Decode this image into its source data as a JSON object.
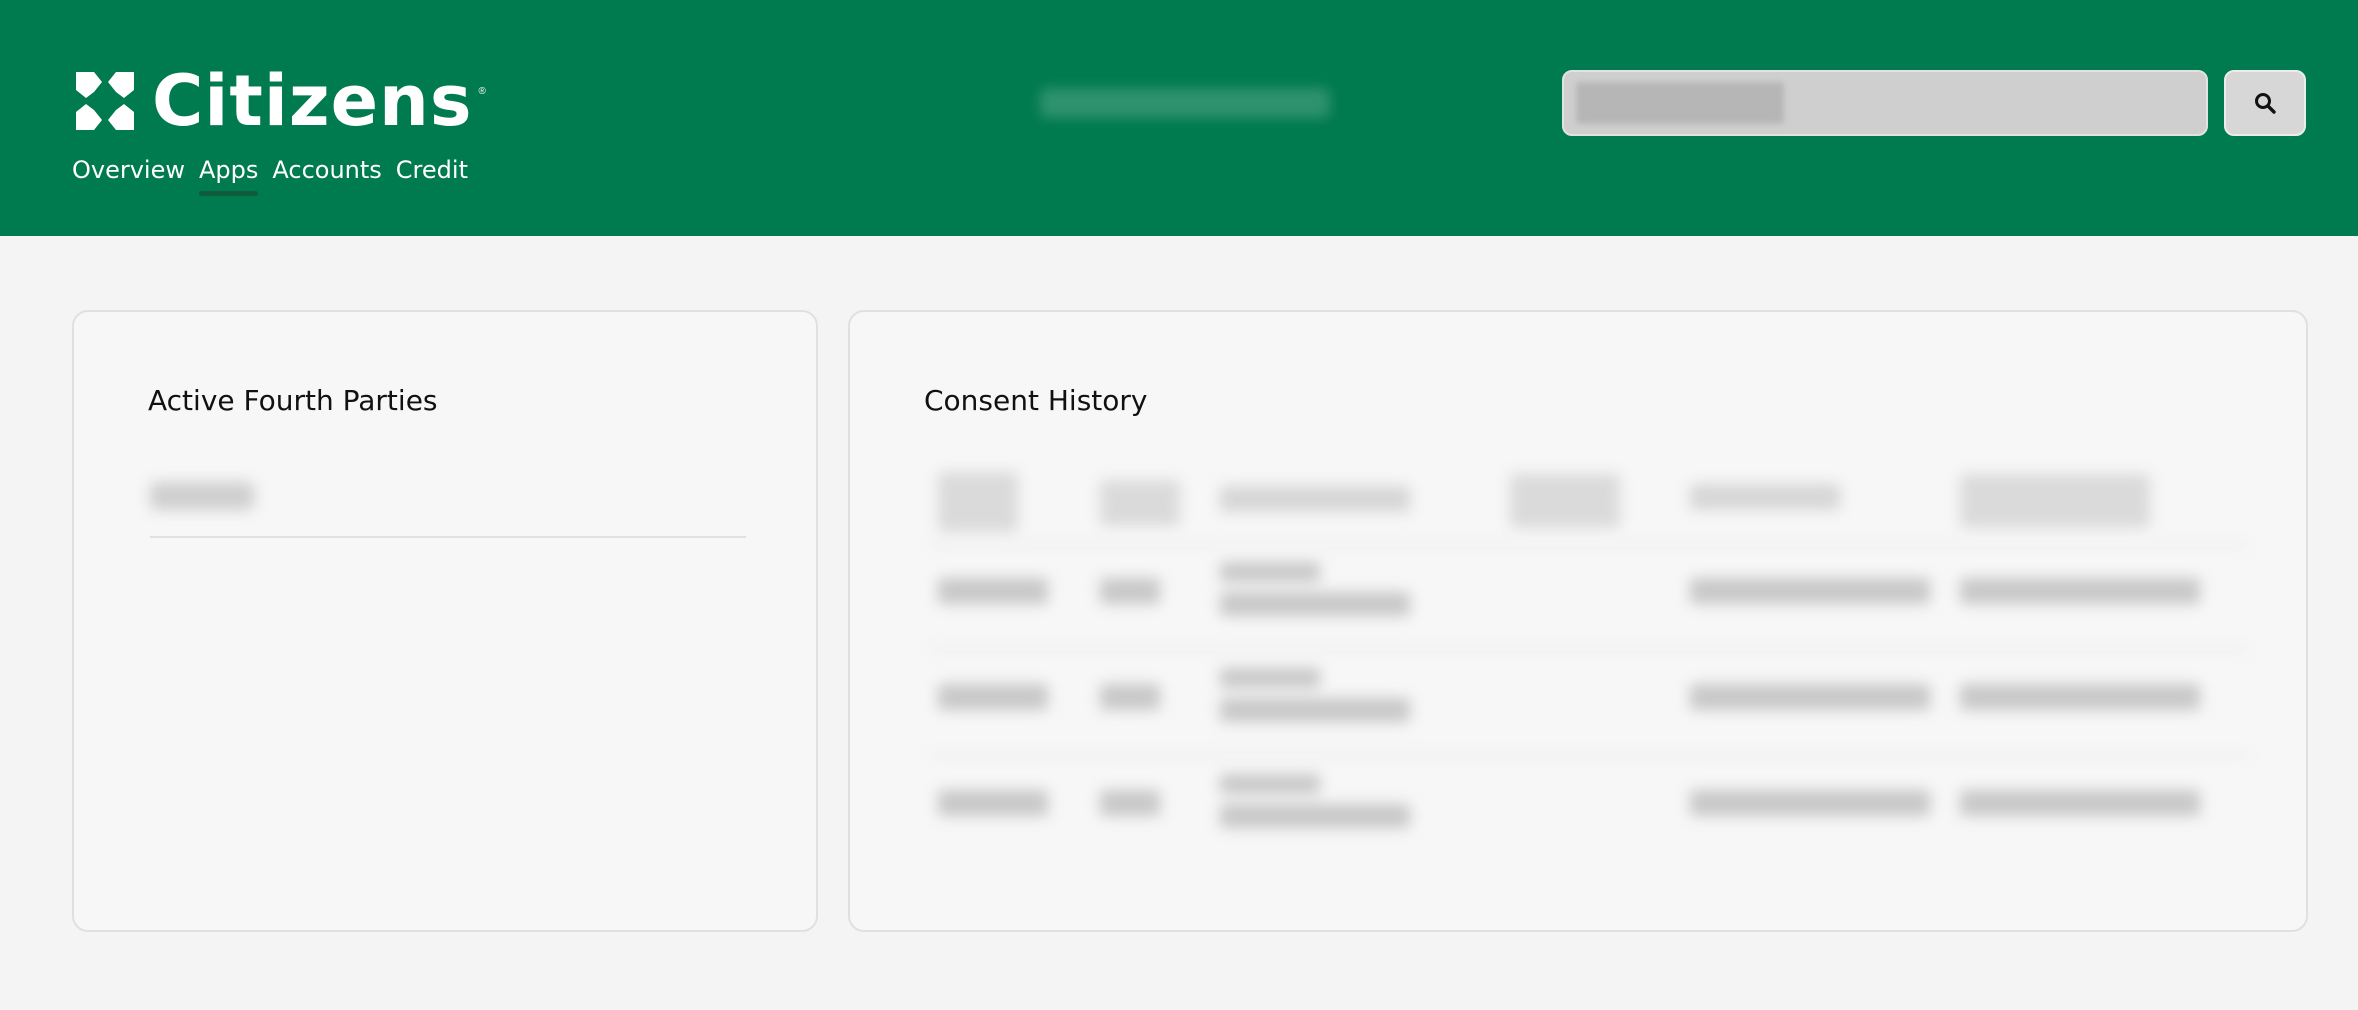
{
  "brand": {
    "name": "Citizens",
    "trademark": "®",
    "accent": "#007a4f"
  },
  "nav": {
    "items": [
      {
        "label": "Overview",
        "active": false
      },
      {
        "label": "Apps",
        "active": true
      },
      {
        "label": "Accounts",
        "active": false
      },
      {
        "label": "Credit",
        "active": false
      }
    ]
  },
  "search": {
    "icon": "search-icon"
  },
  "panels": {
    "fourth_parties": {
      "title": "Active Fourth Parties"
    },
    "consent_history": {
      "title": "Consent History"
    }
  }
}
